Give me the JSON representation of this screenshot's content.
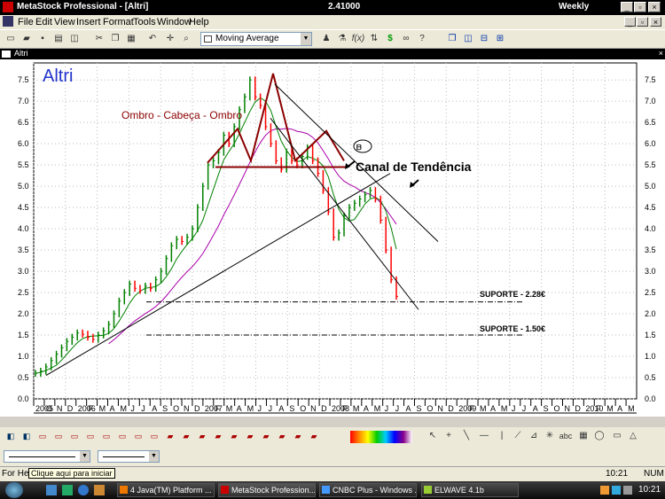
{
  "window": {
    "title": "MetaStock Professional - [Altri]",
    "last_price": "2.41000",
    "periodicity": "Weekly",
    "doc_title": "Altri"
  },
  "menu": [
    "File",
    "Edit",
    "View",
    "Insert",
    "Format",
    "Tools",
    "Window",
    "Help"
  ],
  "toolbar": {
    "indicator": "Moving Average"
  },
  "chart": {
    "security": "Altri",
    "pattern_label": "Ombro - Cabeça - Ombro",
    "channel_label": "Canal de Tendência",
    "support1_label": "SUPORTE - 2.28€",
    "support2_label": "SUPORTE - 1.50€",
    "colors": {
      "pattern": "#8b0000",
      "ma_short": "#008000",
      "ma_long": "#aa00aa",
      "up_bar": "#008000",
      "down_bar": "#ff0000",
      "security_label": "#2233cc"
    }
  },
  "chart_data": {
    "type": "line",
    "title": "Altri",
    "y_ticks": [
      "7.5",
      "7.0",
      "6.5",
      "6.0",
      "5.5",
      "5.0",
      "4.5",
      "4.0",
      "3.5",
      "3.0",
      "2.5",
      "2.0",
      "1.5",
      "1.0",
      "0.5",
      "0.0"
    ],
    "ylim": [
      0,
      7.9
    ],
    "x_labels": [
      "2005",
      "O",
      "N",
      "D",
      "2006",
      "F",
      "M",
      "A",
      "M",
      "J",
      "J",
      "A",
      "S",
      "O",
      "N",
      "D",
      "2007",
      "F",
      "M",
      "A",
      "M",
      "J",
      "J",
      "A",
      "S",
      "O",
      "N",
      "D",
      "2008",
      "F",
      "M",
      "A",
      "M",
      "J",
      "J",
      "A",
      "S",
      "O",
      "N",
      "D",
      "2009",
      "F",
      "M",
      "A",
      "M",
      "J",
      "J",
      "A",
      "S",
      "O",
      "N",
      "D",
      "2010",
      "F",
      "M",
      "A",
      "M"
    ],
    "support_levels": [
      2.28,
      1.5
    ],
    "series": [
      {
        "values": [
          0.6,
          0.65,
          0.75,
          0.9,
          1.05,
          1.2,
          1.35,
          1.45,
          1.55,
          1.52,
          1.45,
          1.4,
          1.5,
          1.6,
          1.75,
          2.0,
          2.3,
          2.5,
          2.7,
          2.6,
          2.55,
          2.65,
          2.6,
          2.8,
          3.0,
          3.3,
          3.6,
          3.75,
          3.7,
          3.8,
          4.0,
          4.5,
          5.0,
          5.5,
          5.6,
          5.8,
          6.2,
          6.0,
          6.4,
          6.8,
          7.1,
          7.5,
          7.1,
          6.9,
          6.4,
          6.0,
          5.6,
          5.4,
          5.8,
          5.6,
          5.5,
          5.7,
          5.9,
          5.6,
          5.3,
          4.9,
          4.4,
          3.8,
          3.9,
          4.3,
          4.5,
          4.6,
          4.7,
          4.8,
          4.9,
          4.7,
          4.2,
          3.5,
          2.8,
          2.41
        ]
      }
    ]
  },
  "bottom": {
    "line_style_1": "",
    "line_style_2": ""
  },
  "status": {
    "help": "For Help",
    "tooltip": "Clique aqui para iniciar",
    "time": "10:21",
    "num": "NUM"
  },
  "taskbar": {
    "tasks": [
      "4 Java(TM) Platform ...",
      "MetaStock Profession...",
      "CNBC Plus - Windows ...",
      "ELWAVE 4.1b"
    ],
    "clock": "10:21"
  }
}
